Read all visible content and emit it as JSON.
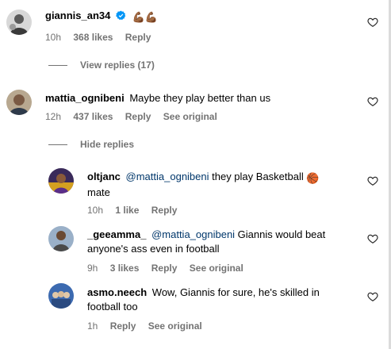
{
  "comments": [
    {
      "username": "giannis_an34",
      "text": "",
      "emoji": "💪🏾💪🏾",
      "verified": true,
      "time": "10h",
      "likes": "368 likes",
      "reply": "Reply",
      "view_replies": "View replies (17)"
    },
    {
      "username": "mattia_ognibeni",
      "text": "Maybe they play better than us",
      "time": "12h",
      "likes": "437 likes",
      "reply": "Reply",
      "see_original": "See original",
      "hide_replies": "Hide replies"
    }
  ],
  "replies": [
    {
      "username": "oltjanc",
      "mention": "@mattia_ognibeni",
      "text_line1": " they play Basketball",
      "text_line2": "mate",
      "emoji": "🏀",
      "time": "10h",
      "likes": "1 like",
      "reply": "Reply"
    },
    {
      "username": "_geeamma_",
      "mention": "@mattia_ognibeni",
      "text_line1": " Giannis would beat",
      "text_line2": "anyone's ass even in football",
      "time": "9h",
      "likes": "3 likes",
      "reply": "Reply",
      "see_original": "See original"
    },
    {
      "username": "asmo.neech",
      "text_line1": "Wow, Giannis for sure, he's skilled in",
      "text_line2": "football too",
      "time": "1h",
      "reply": "Reply",
      "see_original": "See original"
    }
  ],
  "colors": {
    "secondary_text": "#737373",
    "mention": "#00376b",
    "verified": "#0095f6"
  },
  "icons": {
    "like": "heart-outline-icon",
    "verified": "verified-badge-icon"
  }
}
